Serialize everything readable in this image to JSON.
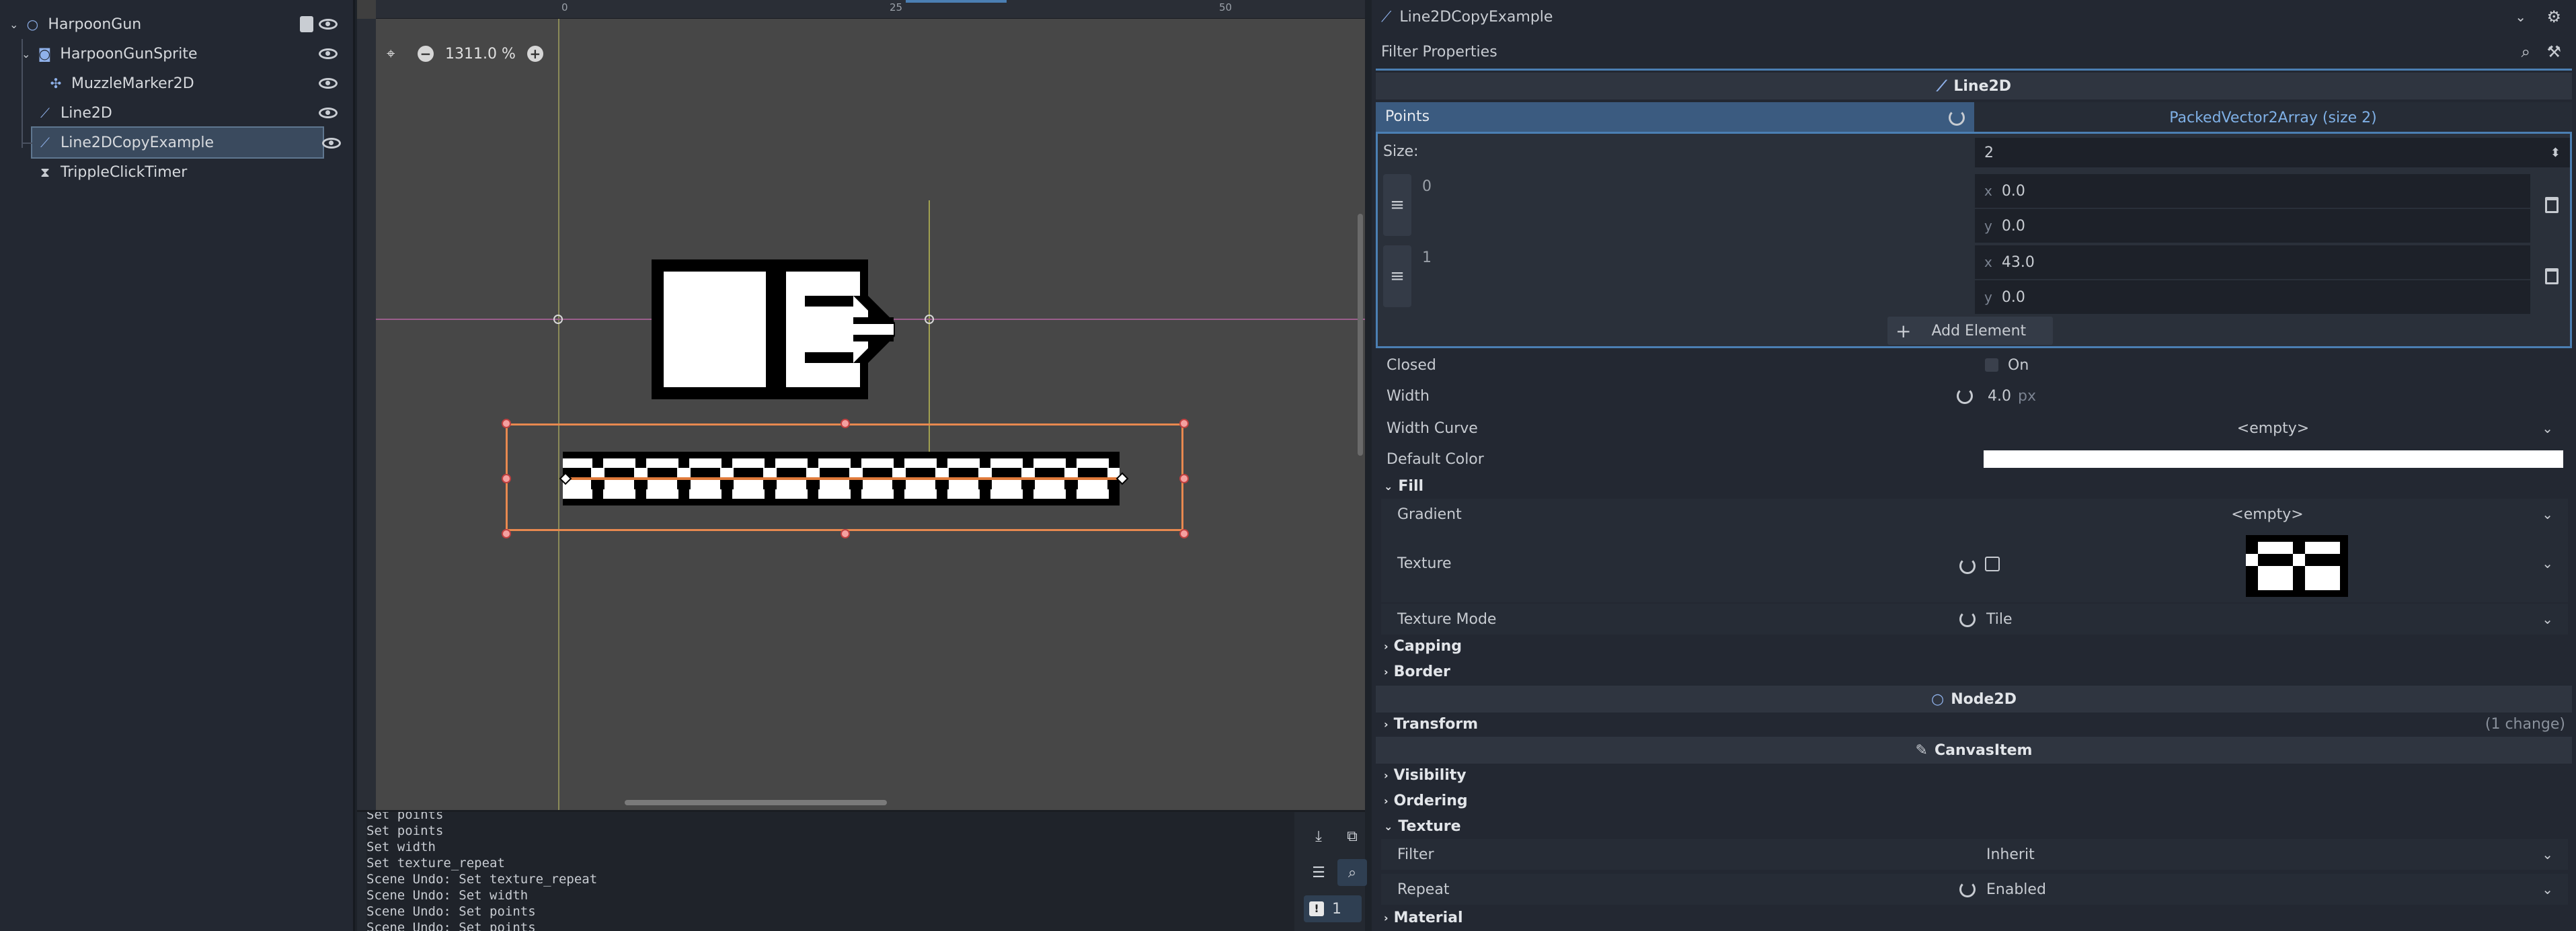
{
  "scene_tree": {
    "nodes": [
      {
        "label": "HarpoonGun",
        "icon": "node2d-icon"
      },
      {
        "label": "HarpoonGunSprite",
        "icon": "sprite-icon"
      },
      {
        "label": "MuzzleMarker2D",
        "icon": "marker-icon"
      },
      {
        "label": "Line2D",
        "icon": "line2d-icon"
      },
      {
        "label": "Line2DCopyExample",
        "icon": "line2d-icon"
      },
      {
        "label": "TrippleClickTimer",
        "icon": "timer-icon"
      }
    ]
  },
  "viewport": {
    "zoom_label": "1311.0 %",
    "ruler_labels": [
      "0",
      "25",
      "50"
    ]
  },
  "output": {
    "lines": [
      "Set points",
      "Set points",
      "Set width",
      "Set texture_repeat",
      "Scene Undo: Set texture_repeat",
      "Scene Undo: Set width",
      "Scene Undo: Set points",
      "Scene Undo: Set points"
    ],
    "error_count": "1"
  },
  "inspector": {
    "node_name": "Line2DCopyExample",
    "filter_placeholder": "Filter Properties",
    "section_line2d": "Line2D",
    "points_label": "Points",
    "points_value": "PackedVector2Array (size 2)",
    "size_label": "Size:",
    "size_value": "2",
    "elements": [
      {
        "index": "0",
        "x": "0.0",
        "y": "0.0"
      },
      {
        "index": "1",
        "x": "43.0",
        "y": "0.0"
      }
    ],
    "axis_x": "x",
    "axis_y": "y",
    "add_element_label": "Add Element",
    "closed_label": "Closed",
    "closed_value": "On",
    "width_label": "Width",
    "width_value": "4.0",
    "width_unit": "px",
    "width_curve_label": "Width Curve",
    "width_curve_value": "<empty>",
    "default_color_label": "Default Color",
    "default_color_value": "#ffffff",
    "fill_label": "Fill",
    "gradient_label": "Gradient",
    "gradient_value": "<empty>",
    "texture_label": "Texture",
    "texture_mode_label": "Texture Mode",
    "texture_mode_value": "Tile",
    "capping_label": "Capping",
    "border_label": "Border",
    "section_node2d": "Node2D",
    "transform_label": "Transform",
    "transform_changes": "(1 change)",
    "section_canvasitem": "CanvasItem",
    "visibility_label": "Visibility",
    "ordering_label": "Ordering",
    "texture_group_label": "Texture",
    "filter_label": "Filter",
    "filter_value": "Inherit",
    "repeat_label": "Repeat",
    "repeat_value": "Enabled",
    "material_label": "Material"
  },
  "colors": {
    "accent": "#4b7fb3",
    "selection_outline": "#e8894f",
    "guide_vertical": "#b8b84a",
    "guide_horizontal": "#b05a9e"
  }
}
